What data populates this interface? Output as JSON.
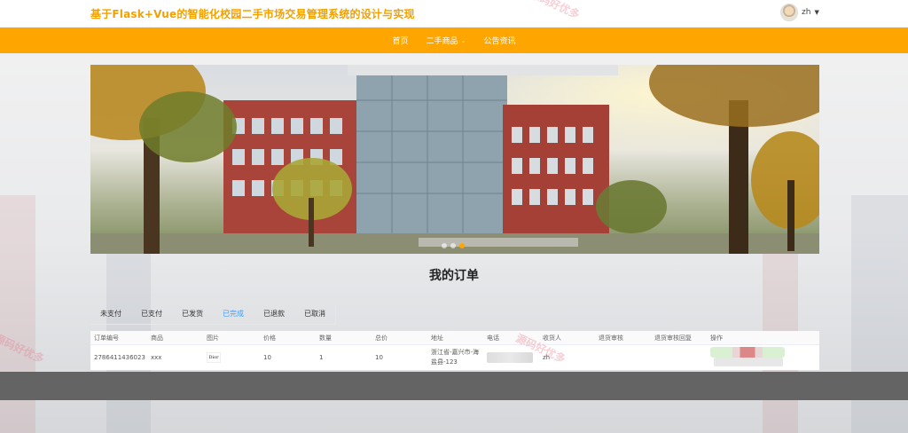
{
  "site": {
    "title": "基于Flask+Vue的智能化校园二手市场交易管理系统的设计与实现"
  },
  "user": {
    "name": "zh"
  },
  "nav": {
    "items": [
      {
        "label": "首页"
      },
      {
        "label": "二手商品"
      },
      {
        "label": "公告资讯"
      }
    ]
  },
  "carousel": {
    "slides": 3,
    "active_index": 2
  },
  "page": {
    "heading": "我的订单"
  },
  "tabs": [
    {
      "label": "未支付"
    },
    {
      "label": "已支付"
    },
    {
      "label": "已发货"
    },
    {
      "label": "已完成"
    },
    {
      "label": "已退款"
    },
    {
      "label": "已取消"
    }
  ],
  "active_tab": "已完成",
  "table": {
    "columns": [
      "订单编号",
      "商品",
      "图片",
      "价格",
      "数量",
      "总价",
      "地址",
      "电话",
      "收货人",
      "退货审核",
      "退货审核回复",
      "操作"
    ],
    "rows": [
      {
        "order_no": "2786411436023",
        "product": "xxx",
        "image_text": "Dior",
        "price": "10",
        "quantity": "1",
        "total": "10",
        "address": "浙江省-嘉兴市-海盐县-123",
        "receiver": "zh"
      }
    ]
  },
  "watermarks": [
    "源码好优多",
    "源码好优多",
    "源码好优多"
  ],
  "colors": {
    "accent": "#ffa500",
    "title": "#f2a100",
    "active_tab": "#409eff",
    "footer": "#646464"
  }
}
